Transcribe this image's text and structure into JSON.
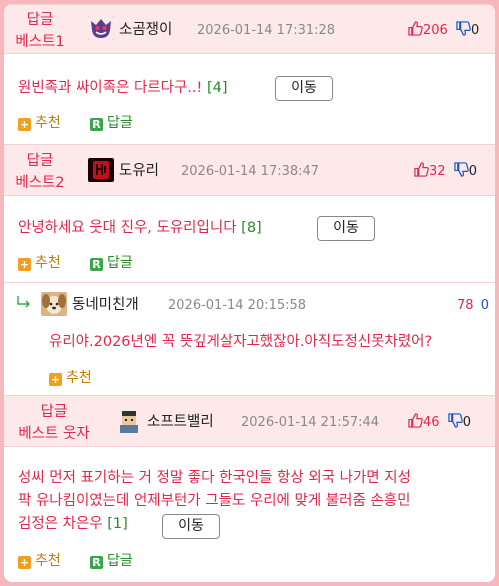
{
  "comments": [
    {
      "badge_line1": "답글",
      "badge_line2": "베스트1",
      "nickname": "소곰쟁이",
      "avatar_icon": "gengar-icon",
      "date": "2026-01-14 17:31:28",
      "upvotes": "206",
      "downvotes": "0",
      "body": "원빈족과 싸이족은 다르다구..!",
      "reply_count": "[4]",
      "move_label": "이동",
      "recommend_label": "추천",
      "reply_label": "답글"
    },
    {
      "badge_line1": "답글",
      "badge_line2": "베스트2",
      "nickname": "도유리",
      "avatar_icon": "red-character-icon",
      "date": "2026-01-14 17:38:47",
      "upvotes": "32",
      "downvotes": "0",
      "body": "안녕하세요 웃대 진우, 도유리입니다",
      "reply_count": "[8]",
      "move_label": "이동",
      "recommend_label": "추천",
      "reply_label": "답글"
    },
    {
      "nickname": "동네미친개",
      "avatar_icon": "dog-icon",
      "date": "2026-01-14 20:15:58",
      "upvotes": "78",
      "downvotes": "0",
      "body": "유리야.2026년엔 꼭 뜻깊게살자고했잖아.아직도정신못차렸어?",
      "recommend_label": "추천"
    },
    {
      "badge_line1": "답글",
      "badge_line2": "베스트 웃자",
      "nickname": "소프트밸리",
      "avatar_icon": "pixel-person-icon",
      "date": "2026-01-14 21:57:44",
      "upvotes": "46",
      "downvotes": "0",
      "body_line1": "성씨 먼저 표기하는 거 정말 좋다 한국인들 항상 외국 나가면 지성",
      "body_line2": "팍 유나킴이였는데 언제부턴가 그들도 우리에 맞게 불러줌 손흥민",
      "body_line3": "김정은 차은우",
      "reply_count": "[1]",
      "move_label": "이동",
      "recommend_label": "추천",
      "reply_label": "답글"
    }
  ],
  "colors": {
    "accent": "#e2284a",
    "frame": "#f6b7bd",
    "header_bg": "#fde8ea",
    "count_green": "#2a8a2a"
  }
}
